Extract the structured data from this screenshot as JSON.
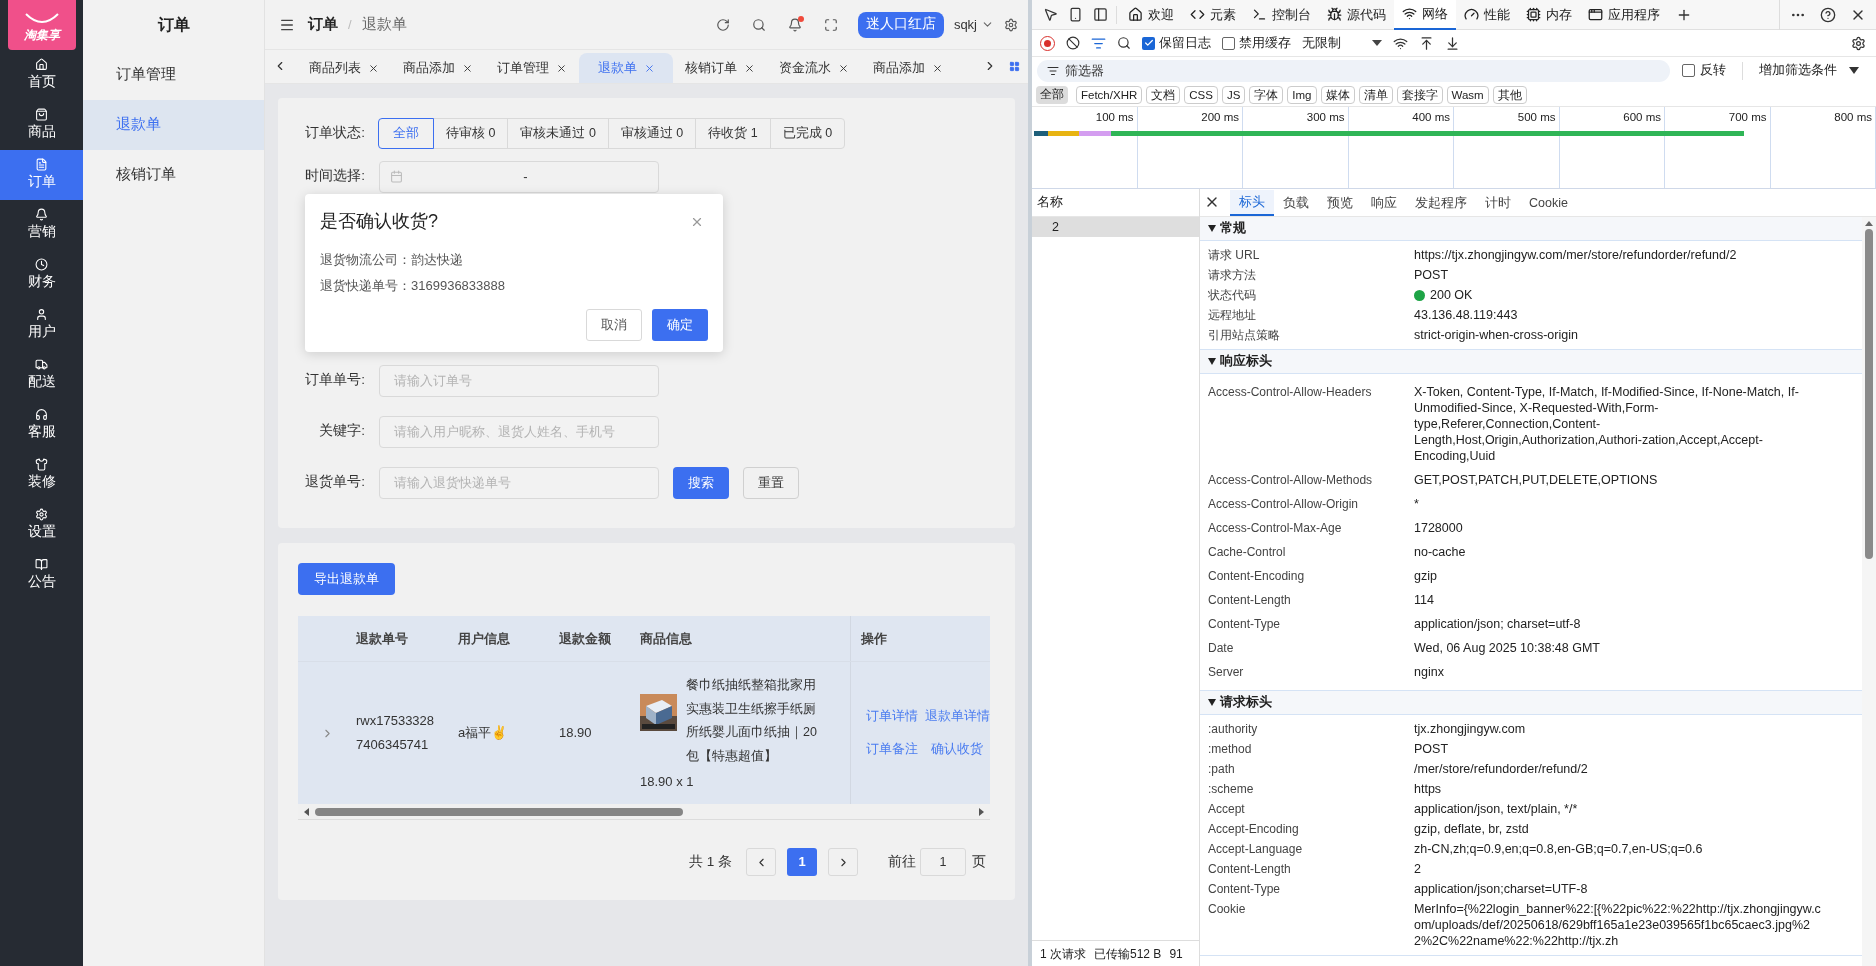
{
  "app": {
    "logo": "淘集享",
    "nav": [
      {
        "label": "首页",
        "selected": false
      },
      {
        "label": "商品",
        "selected": false
      },
      {
        "label": "订单",
        "selected": true
      },
      {
        "label": "营销",
        "selected": false
      },
      {
        "label": "财务",
        "selected": false
      },
      {
        "label": "用户",
        "selected": false
      },
      {
        "label": "配送",
        "selected": false
      },
      {
        "label": "客服",
        "selected": false
      },
      {
        "label": "装修",
        "selected": false
      },
      {
        "label": "设置",
        "selected": false
      },
      {
        "label": "公告",
        "selected": false
      }
    ],
    "submenu": {
      "title": "订单",
      "items": [
        {
          "label": "订单管理",
          "selected": false
        },
        {
          "label": "退款单",
          "selected": true
        },
        {
          "label": "核销订单",
          "selected": false
        }
      ]
    },
    "header": {
      "breadcrumb": [
        "订单",
        "退款单"
      ],
      "breadcrumb_separator": "/",
      "store_button": "迷人口红店",
      "user": "sqkj"
    },
    "tabs": [
      {
        "label": "商品列表",
        "selected": false
      },
      {
        "label": "商品添加",
        "selected": false
      },
      {
        "label": "订单管理",
        "selected": false
      },
      {
        "label": "退款单",
        "selected": true
      },
      {
        "label": "核销订单",
        "selected": false
      },
      {
        "label": "资金流水",
        "selected": false
      },
      {
        "label": "商品添加",
        "selected": false
      }
    ],
    "filter": {
      "status_label": "订单状态:",
      "status_options": [
        {
          "label": "全部",
          "selected": true
        },
        {
          "label": "待审核 0",
          "selected": false
        },
        {
          "label": "审核未通过 0",
          "selected": false
        },
        {
          "label": "审核通过 0",
          "selected": false
        },
        {
          "label": "待收货 1",
          "selected": false
        },
        {
          "label": "已完成 0",
          "selected": false
        }
      ],
      "date_label": "时间选择:",
      "date_separator": "-",
      "fields": [
        {
          "label": "订单单号:",
          "placeholder": "请输入订单号"
        },
        {
          "label": "关键字:",
          "placeholder": "请输入用户昵称、退货人姓名、手机号"
        },
        {
          "label": "退货单号:",
          "placeholder": "请输入退货快递单号"
        }
      ],
      "search_button": "搜索",
      "reset_button": "重置"
    },
    "dialog": {
      "title": "是否确认收货?",
      "lines": [
        "退货物流公司：韵达快递",
        "退货快递单号：3169936833888"
      ],
      "cancel_button": "取消",
      "confirm_button": "确定"
    },
    "table": {
      "export_button": "导出退款单",
      "columns": [
        "退款单号",
        "用户信息",
        "退款金额",
        "商品信息",
        "操作"
      ],
      "rows": [
        {
          "refund_no": "rwx175333287406345741",
          "user": "a福平✌",
          "amount": "18.90",
          "product_name": "餐巾纸抽纸整箱批家用实惠装卫生纸擦手纸厕所纸婴儿面巾纸抽｜20包【特惠超值】",
          "product_qty": "18.90 x 1",
          "actions": [
            "订单详情",
            "退款单详情",
            "订单备注",
            "确认收货"
          ]
        }
      ]
    },
    "pagination": {
      "total": "共 1 条",
      "pages": [
        {
          "label": "1",
          "selected": true
        }
      ],
      "goto_label": "前往",
      "goto_value": "1",
      "page_suffix": "页"
    }
  },
  "devtools": {
    "tabs": [
      {
        "label": "欢迎",
        "selected": false
      },
      {
        "label": "元素",
        "selected": false
      },
      {
        "label": "控制台",
        "selected": false
      },
      {
        "label": "源代码",
        "selected": false
      },
      {
        "label": "网络",
        "selected": true
      },
      {
        "label": "性能",
        "selected": false
      },
      {
        "label": "内存",
        "selected": false
      },
      {
        "label": "应用程序",
        "selected": false
      }
    ],
    "preserve_log": {
      "label": "保留日志",
      "checked": true
    },
    "disable_cache": {
      "label": "禁用缓存",
      "checked": false
    },
    "throttle": "无限制",
    "filter": {
      "placeholder": "筛选器",
      "invert": {
        "label": "反转",
        "checked": false
      },
      "more_filters": "增加筛选条件"
    },
    "type_filters": [
      {
        "label": "全部",
        "selected": true
      },
      {
        "label": "Fetch/XHR",
        "selected": false
      },
      {
        "label": "文档",
        "selected": false
      },
      {
        "label": "CSS",
        "selected": false
      },
      {
        "label": "JS",
        "selected": false
      },
      {
        "label": "字体",
        "selected": false
      },
      {
        "label": "Img",
        "selected": false
      },
      {
        "label": "媒体",
        "selected": false
      },
      {
        "label": "清单",
        "selected": false
      },
      {
        "label": "套接字",
        "selected": false
      },
      {
        "label": "Wasm",
        "selected": false
      },
      {
        "label": "其他",
        "selected": false
      }
    ],
    "timeline_ticks": [
      "100 ms",
      "200 ms",
      "300 ms",
      "400 ms",
      "500 ms",
      "600 ms",
      "700 ms",
      "800 ms"
    ],
    "requests": {
      "column": "名称",
      "items": [
        {
          "name": "2",
          "selected": true
        }
      ]
    },
    "detail_tabs": [
      {
        "label": "标头",
        "selected": true
      },
      {
        "label": "负载",
        "selected": false
      },
      {
        "label": "预览",
        "selected": false
      },
      {
        "label": "响应",
        "selected": false
      },
      {
        "label": "发起程序",
        "selected": false
      },
      {
        "label": "计时",
        "selected": false
      },
      {
        "label": "Cookie",
        "selected": false
      }
    ],
    "sections": [
      {
        "title": "常规",
        "expanded": true,
        "rows": [
          {
            "name": "请求 URL",
            "value": "https://tjx.zhongjingyw.com/mer/store/refundorder/refund/2"
          },
          {
            "name": "请求方法",
            "value": "POST"
          },
          {
            "name": "状态代码",
            "value": "200 OK",
            "kind": "status"
          },
          {
            "name": "远程地址",
            "value": "43.136.48.119:443"
          },
          {
            "name": "引用站点策略",
            "value": "strict-origin-when-cross-origin"
          }
        ]
      },
      {
        "title": "响应标头",
        "expanded": true,
        "rows": [
          {
            "name": "Access-Control-Allow-Headers",
            "value": "X-Token, Content-Type, If-Match, If-Modified-Since, If-None-Match, If-Unmodified-Since, X-Requested-With,Form-type,Referer,Connection,Content-Length,Host,Origin,Authorization,Authori-zation,Accept,Accept-Encoding,Uuid"
          },
          {
            "name": "Access-Control-Allow-Methods",
            "value": "GET,POST,PATCH,PUT,DELETE,OPTIONS"
          },
          {
            "name": "Access-Control-Allow-Origin",
            "value": "*"
          },
          {
            "name": "Access-Control-Max-Age",
            "value": "1728000"
          },
          {
            "name": "Cache-Control",
            "value": "no-cache"
          },
          {
            "name": "Content-Encoding",
            "value": "gzip"
          },
          {
            "name": "Content-Length",
            "value": "114"
          },
          {
            "name": "Content-Type",
            "value": "application/json; charset=utf-8"
          },
          {
            "name": "Date",
            "value": "Wed, 06 Aug 2025 10:38:48 GMT"
          },
          {
            "name": "Server",
            "value": "nginx"
          }
        ]
      },
      {
        "title": "请求标头",
        "expanded": true,
        "rows": [
          {
            "name": ":authority",
            "value": "tjx.zhongjingyw.com"
          },
          {
            "name": ":method",
            "value": "POST"
          },
          {
            "name": ":path",
            "value": "/mer/store/refundorder/refund/2"
          },
          {
            "name": ":scheme",
            "value": "https"
          },
          {
            "name": "Accept",
            "value": "application/json, text/plain, */*"
          },
          {
            "name": "Accept-Encoding",
            "value": "gzip, deflate, br, zstd"
          },
          {
            "name": "Accept-Language",
            "value": "zh-CN,zh;q=0.9,en;q=0.8,en-GB;q=0.7,en-US;q=0.6"
          },
          {
            "name": "Content-Length",
            "value": "2"
          },
          {
            "name": "Content-Type",
            "value": "application/json;charset=UTF-8"
          },
          {
            "name": "Cookie",
            "value": "MerInfo={%22login_banner%22:[{%22pic%22:%22http://tjx.zhongjingyw.com/uploads/def/20250618/629bff165a1e23e039565f1bc65caec3.jpg%22%2C%22name%22:%22http://tjx.zh"
          }
        ]
      }
    ],
    "status_bar": [
      "1 次请求",
      "已传输512 B",
      "91"
    ]
  }
}
